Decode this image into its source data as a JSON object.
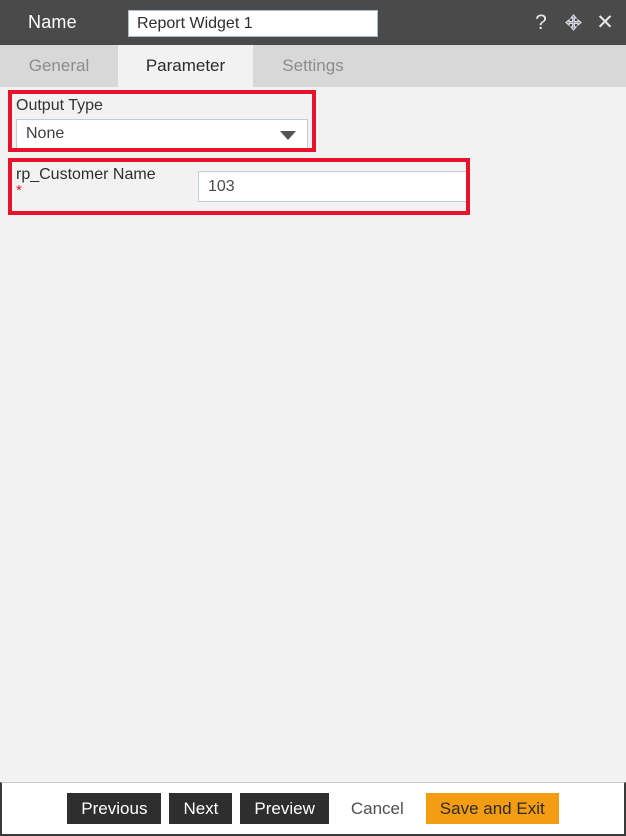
{
  "titlebar": {
    "name_label": "Name",
    "name_value": "Report Widget 1",
    "name_placeholder": "",
    "help_icon": "question-mark-icon",
    "move_icon": "move-arrows-icon",
    "close_icon": "close-x-icon",
    "background_color": "#4a4a4a"
  },
  "tabs": [
    {
      "id": "general",
      "label": "General",
      "active": false
    },
    {
      "id": "parameter",
      "label": "Parameter",
      "active": true
    },
    {
      "id": "settings",
      "label": "Settings",
      "active": false
    }
  ],
  "form": {
    "output_type": {
      "label": "Output Type",
      "selected": "None",
      "dropdown_icon": "chevron-down-icon"
    },
    "parameter": {
      "label": "rp_Customer Name",
      "required_marker": "*",
      "value": "103",
      "placeholder": ""
    }
  },
  "annotations": {
    "highlight_color": "#e8122a",
    "boxes": [
      {
        "id": "output-type-highlight",
        "target": "output_type"
      },
      {
        "id": "parameter-highlight",
        "target": "parameter"
      }
    ]
  },
  "footer": {
    "buttons": [
      {
        "id": "previous",
        "label": "Previous",
        "style": "dark"
      },
      {
        "id": "next",
        "label": "Next",
        "style": "dark"
      },
      {
        "id": "preview",
        "label": "Preview",
        "style": "dark"
      },
      {
        "id": "cancel",
        "label": "Cancel",
        "style": "plain"
      },
      {
        "id": "save-and-exit",
        "label": "Save and Exit",
        "style": "primary"
      }
    ]
  },
  "colors": {
    "titlebar": "#4a4a4a",
    "tabbar": "#d8d8d8",
    "body": "#f2f2f2",
    "accent": "#f59d12",
    "highlight": "#e8122a",
    "button_dark": "#2e2e2e"
  }
}
